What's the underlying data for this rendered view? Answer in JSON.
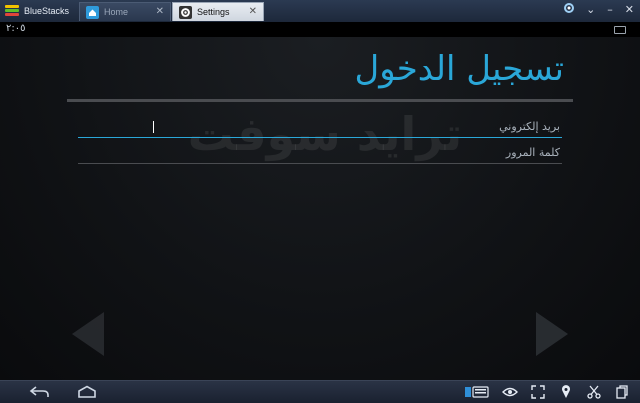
{
  "titlebar": {
    "brand": "BlueStacks",
    "tabs": [
      {
        "label": "Home",
        "icon": "home-icon",
        "active": false
      },
      {
        "label": "Settings",
        "icon": "gear-icon",
        "active": true
      }
    ]
  },
  "status": {
    "clock": "٢:٠٥"
  },
  "login": {
    "title": "تسجيل الدخول",
    "watermark": "ترايد سوفت",
    "email_placeholder": "بريد إلكتروني",
    "password_placeholder": "كلمة المرور"
  },
  "colors": {
    "accent": "#2aa7d8",
    "titlebar": "#1d283a",
    "background": "#101215"
  }
}
